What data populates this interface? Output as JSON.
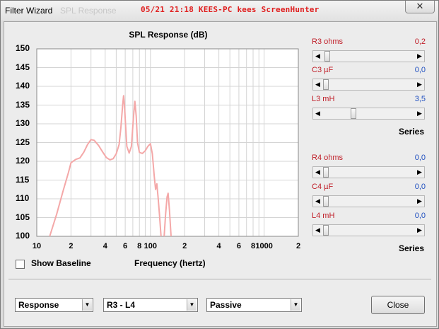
{
  "window": {
    "title": "Filter Wizard",
    "ghost_title": "SPL Response",
    "watermark": "05/21  21:18  KEES-PC  kees  ScreenHunter",
    "close_glyph": "✕"
  },
  "chart_data": {
    "type": "line",
    "title": "SPL Response (dB)",
    "xlabel": "Frequency (hertz)",
    "ylabel": "",
    "xscale": "log",
    "xlim": [
      10,
      2000
    ],
    "ylim": [
      100,
      150
    ],
    "grid": true,
    "y_ticks": [
      "150",
      "145",
      "140",
      "135",
      "130",
      "125",
      "120",
      "115",
      "110",
      "105",
      "100"
    ],
    "x_ticks": [
      {
        "label": "10",
        "value": 10
      },
      {
        "label": "2",
        "value": 20
      },
      {
        "label": "4",
        "value": 40
      },
      {
        "label": "6",
        "value": 60
      },
      {
        "label": "8",
        "value": 80
      },
      {
        "label": "100",
        "value": 100
      },
      {
        "label": "2",
        "value": 200
      },
      {
        "label": "4",
        "value": 400
      },
      {
        "label": "6",
        "value": 600
      },
      {
        "label": "8",
        "value": 800
      },
      {
        "label": "1000",
        "value": 1000
      },
      {
        "label": "2",
        "value": 2000
      }
    ],
    "series_color": "#f4a8a8",
    "segments": [
      [
        [
          13,
          100
        ],
        [
          15,
          106
        ],
        [
          17,
          112
        ],
        [
          19,
          117
        ],
        [
          20,
          119.6
        ],
        [
          22,
          120.5
        ],
        [
          24,
          120.9
        ],
        [
          26,
          122.5
        ],
        [
          28,
          124.5
        ],
        [
          30,
          125.8
        ],
        [
          32,
          125.6
        ],
        [
          35,
          124.2
        ],
        [
          38,
          122.5
        ],
        [
          41,
          121
        ],
        [
          44,
          120.4
        ],
        [
          47,
          120.7
        ],
        [
          50,
          122
        ],
        [
          53,
          124.5
        ],
        [
          55,
          129
        ],
        [
          57,
          135
        ],
        [
          58,
          137.5
        ],
        [
          59,
          135
        ],
        [
          62,
          124
        ],
        [
          65,
          122.2
        ],
        [
          68,
          124
        ],
        [
          71,
          132
        ],
        [
          73,
          136
        ],
        [
          75,
          132
        ],
        [
          77,
          125
        ],
        [
          80,
          122.4
        ],
        [
          85,
          122.1
        ],
        [
          90,
          122.8
        ],
        [
          95,
          124
        ],
        [
          100,
          124.7
        ],
        [
          104,
          122
        ],
        [
          108,
          116
        ],
        [
          111,
          112.5
        ],
        [
          114,
          114
        ],
        [
          117,
          110
        ],
        [
          120,
          106
        ],
        [
          124,
          100
        ]
      ],
      [
        [
          132,
          100
        ],
        [
          136,
          106
        ],
        [
          140,
          110.5
        ],
        [
          143,
          111.5
        ],
        [
          147,
          107
        ],
        [
          152,
          100
        ]
      ]
    ]
  },
  "options": {
    "show_baseline_label": "Show Baseline",
    "show_baseline_checked": false
  },
  "sliders": [
    {
      "label": "R3  ohms",
      "value": "0,2",
      "value_color": "red",
      "position": 0.02
    },
    {
      "label": "C3  µF",
      "value": "0,0",
      "value_color": "blue",
      "position": 0.0
    },
    {
      "label": "L3  mH",
      "value": "3,5",
      "value_color": "blue",
      "position": 0.32
    },
    {
      "label": "R4  ohms",
      "value": "0,0",
      "value_color": "blue",
      "position": 0.0
    },
    {
      "label": "C4  µF",
      "value": "0,0",
      "value_color": "blue",
      "position": 0.0
    },
    {
      "label": "L4  mH",
      "value": "0,0",
      "value_color": "blue",
      "position": 0.0
    }
  ],
  "series_labels": [
    "Series",
    "Series"
  ],
  "footer": {
    "view_select": "Response",
    "section_select": "R3 - L4",
    "type_select": "Passive",
    "close_label": "Close"
  },
  "icons": {
    "left_arrow": "◀",
    "right_arrow": "▶",
    "dropdown_arrow": "▼"
  }
}
